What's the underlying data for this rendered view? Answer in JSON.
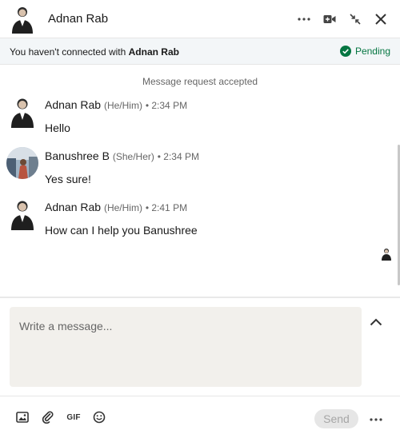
{
  "header": {
    "name": "Adnan Rab",
    "icons": [
      "more-dots-icon",
      "video-call-icon",
      "minimize-icon",
      "close-icon"
    ]
  },
  "banner": {
    "prefix": "You haven't connected with ",
    "name": "Adnan Rab",
    "status": "Pending",
    "status_color": "#057642",
    "status_icon": "check-circle-icon"
  },
  "thread": {
    "system_message": "Message request accepted",
    "messages": [
      {
        "name": "Adnan Rab",
        "pronouns": "(He/Him)",
        "time": "• 2:34 PM",
        "text": "Hello"
      },
      {
        "name": "Banushree B",
        "pronouns": "(She/Her)",
        "time": "• 2:34 PM",
        "text": "Yes sure!"
      },
      {
        "name": "Adnan Rab",
        "pronouns": "(He/Him)",
        "time": "• 2:41 PM",
        "text": "How can I help you Banushree"
      }
    ]
  },
  "composer": {
    "placeholder": "Write a message...",
    "value": ""
  },
  "toolbar": {
    "icons": [
      "image-icon",
      "attachment-icon",
      "gif-icon",
      "emoji-icon"
    ],
    "gif_label": "GIF",
    "send_label": "Send"
  },
  "colors": {
    "accent_green": "#057642",
    "composer_bg": "#f2f0ec",
    "banner_bg": "#f3f6f8"
  }
}
